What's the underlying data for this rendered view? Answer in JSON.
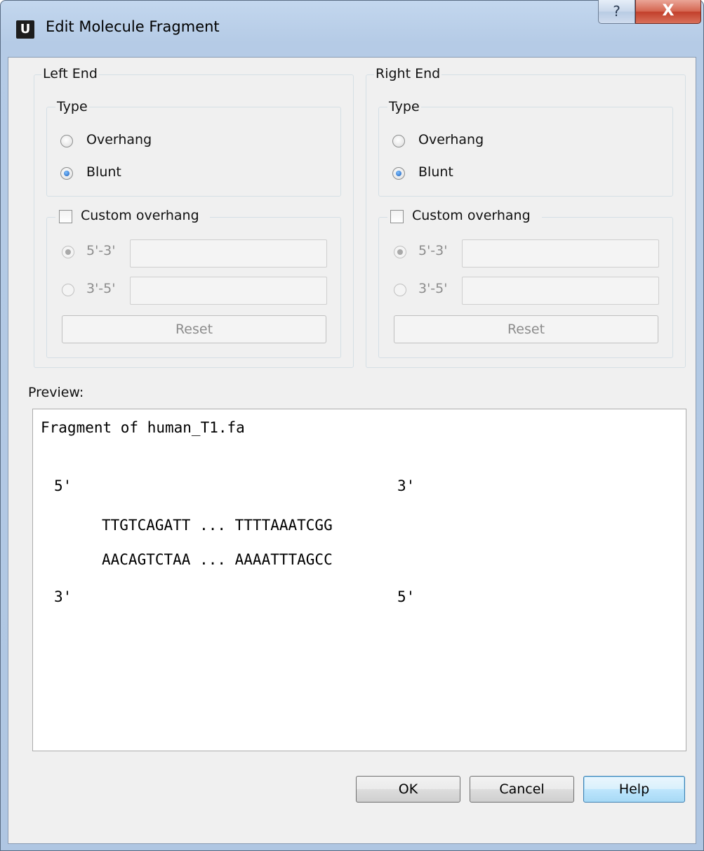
{
  "window": {
    "title": "Edit Molecule Fragment",
    "app_icon_letter": "U",
    "help_glyph": "?",
    "close_glyph": "X"
  },
  "left_end": {
    "label": "Left End",
    "type_label": "Type",
    "overhang_label": "Overhang",
    "blunt_label": "Blunt",
    "selected_type": "Blunt",
    "custom_overhang_label": "Custom overhang",
    "custom_overhang_checked": false,
    "dir_53_label": "5'-3'",
    "dir_35_label": "3'-5'",
    "value_53": "",
    "value_35": "",
    "reset_label": "Reset"
  },
  "right_end": {
    "label": "Right End",
    "type_label": "Type",
    "overhang_label": "Overhang",
    "blunt_label": "Blunt",
    "selected_type": "Blunt",
    "custom_overhang_label": "Custom overhang",
    "custom_overhang_checked": false,
    "dir_53_label": "5'-3'",
    "dir_35_label": "3'-5'",
    "value_53": "",
    "value_35": "",
    "reset_label": "Reset"
  },
  "preview": {
    "label": "Preview:",
    "title": "Fragment of human_T1.fa",
    "top_left_end": "5'",
    "top_right_end": "3'",
    "top_strand": "TTGTCAGATT ... TTTTAAATCGG",
    "bottom_strand": "AACAGTCTAA ... AAAATTTAGCC",
    "bottom_left_end": "3'",
    "bottom_right_end": "5'"
  },
  "buttons": {
    "ok": "OK",
    "cancel": "Cancel",
    "help": "Help"
  }
}
